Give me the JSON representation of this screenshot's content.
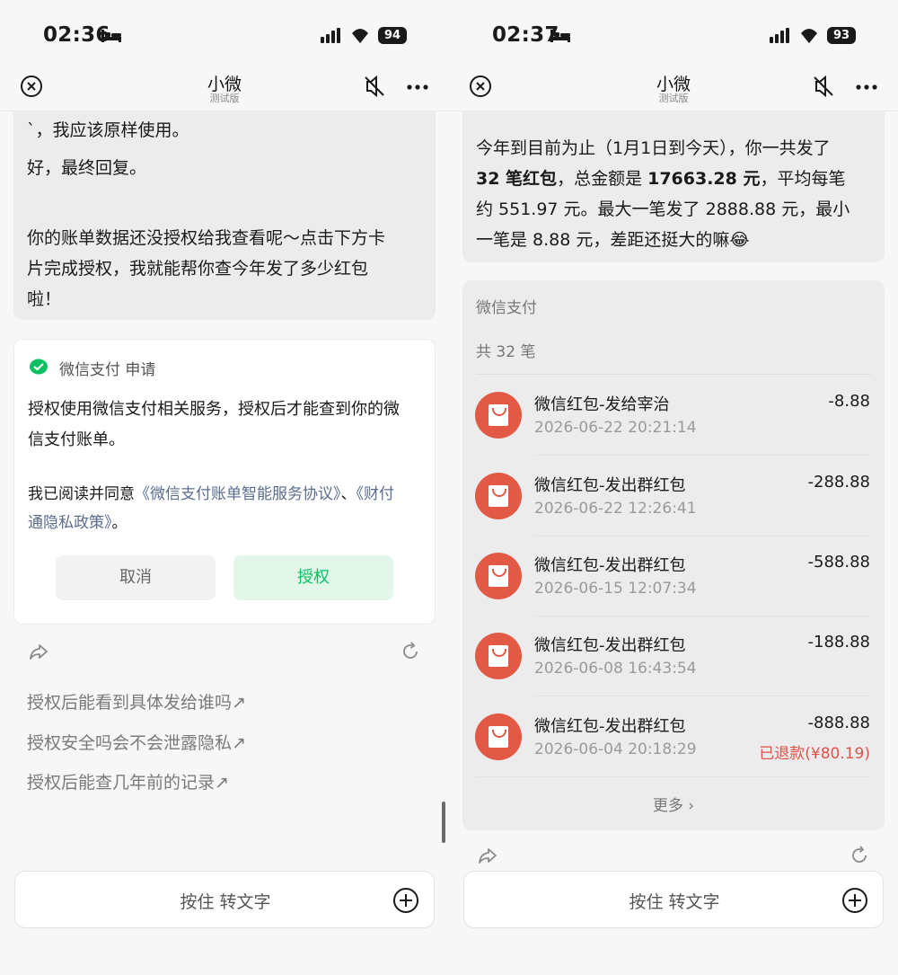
{
  "left": {
    "status": {
      "time": "02:36",
      "battery": "94"
    },
    "nav": {
      "title": "小微",
      "subtitle": "测试版"
    },
    "message": {
      "line1": "`，我应该原样使用。",
      "line2": "好，最终回复。",
      "line3": "你的账单数据还没授权给我查看呢～点击下方卡",
      "line4": "片完成授权，我就能帮你查今年发了多少红包",
      "line5": "啦！"
    },
    "auth_card": {
      "title": "微信支付 申请",
      "desc_line1": "授权使用微信支付相关服务，授权后才能查到你的微",
      "desc_line2": "信支付账单。",
      "agree_prefix": "我已阅读并同意",
      "agree_link1": "《微信支付账单智能服务协议》",
      "agree_sep": "、",
      "agree_link2a": "《财付",
      "agree_link2b": "通隐私政策》",
      "agree_suffix": "。",
      "cancel_label": "取消",
      "auth_label": "授权"
    },
    "suggestions": [
      "授权后能看到具体发给谁吗↗",
      "授权安全吗会不会泄露隐私↗",
      "授权后能查几年前的记录↗"
    ],
    "input": {
      "voice_label": "按住 转文字"
    }
  },
  "right": {
    "status": {
      "time": "02:37",
      "battery": "93"
    },
    "nav": {
      "title": "小微",
      "subtitle": "测试版"
    },
    "summary": {
      "l1": "今年到目前为止（1月1日到今天），你一共发了",
      "l2_count": "32 笔红包",
      "l2_mid": "，总金额是 ",
      "l2_total": "17663.28 元",
      "l2_end": "，平均每笔",
      "l3": "约 551.97 元。最大一笔发了 2888.88 元，最小",
      "l4": "一笔是 8.88 元，差距还挺大的嘛😂"
    },
    "bill_card": {
      "title": "微信支付",
      "count": "共 32 笔",
      "transactions": [
        {
          "name": "微信红包-发给宰治",
          "date": "2026-06-22 20:21:14",
          "amount": "-8.88",
          "note": ""
        },
        {
          "name": "微信红包-发出群红包",
          "date": "2026-06-22 12:26:41",
          "amount": "-288.88",
          "note": ""
        },
        {
          "name": "微信红包-发出群红包",
          "date": "2026-06-15 12:07:34",
          "amount": "-588.88",
          "note": ""
        },
        {
          "name": "微信红包-发出群红包",
          "date": "2026-06-08 16:43:54",
          "amount": "-188.88",
          "note": ""
        },
        {
          "name": "微信红包-发出群红包",
          "date": "2026-06-04 20:18:29",
          "amount": "-888.88",
          "note": "已退款(¥80.19)"
        }
      ],
      "more_label": "更多 ›"
    },
    "input": {
      "voice_label": "按住 转文字"
    }
  },
  "colors": {
    "wechat_green": "#07c160",
    "red_packet": "#e25a45",
    "refund_red": "#e0514b",
    "link_blue": "#5a6d8f"
  },
  "icons": [
    "bed-icon",
    "signal-icon",
    "wifi-icon",
    "close-icon",
    "mute-icon",
    "more-icon",
    "wechat-pay-icon",
    "share-icon",
    "refresh-icon",
    "plus-icon",
    "red-packet-icon"
  ]
}
